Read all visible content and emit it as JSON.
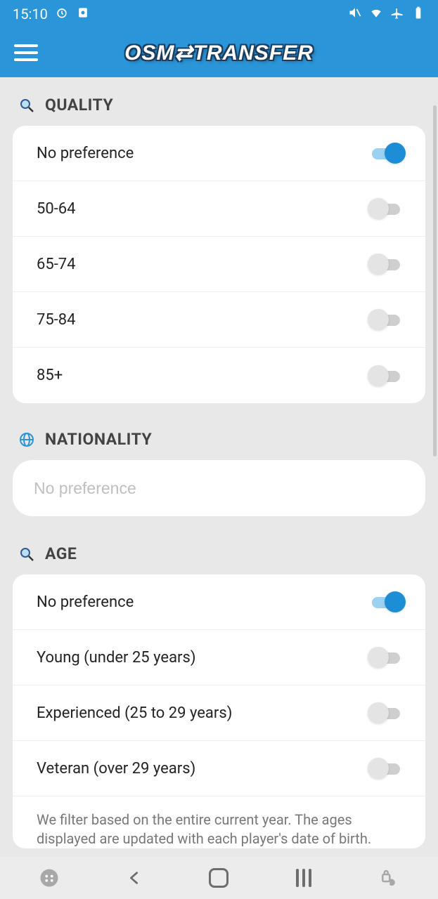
{
  "status": {
    "time": "15:10"
  },
  "app": {
    "title": "OSM⇄TRANSFER"
  },
  "sections": {
    "quality": {
      "title": "QUALITY",
      "items": [
        {
          "label": "No preference",
          "on": true
        },
        {
          "label": "50-64",
          "on": false
        },
        {
          "label": "65-74",
          "on": false
        },
        {
          "label": "75-84",
          "on": false
        },
        {
          "label": "85+",
          "on": false
        }
      ]
    },
    "nationality": {
      "title": "NATIONALITY",
      "placeholder": "No preference",
      "value": ""
    },
    "age": {
      "title": "AGE",
      "items": [
        {
          "label": "No preference",
          "on": true
        },
        {
          "label": "Young (under 25 years)",
          "on": false
        },
        {
          "label": "Experienced (25 to 29 years)",
          "on": false
        },
        {
          "label": "Veteran (over 29 years)",
          "on": false
        }
      ],
      "footnote": "We filter based on the entire current year. The ages displayed are updated with each player's date of birth."
    }
  }
}
